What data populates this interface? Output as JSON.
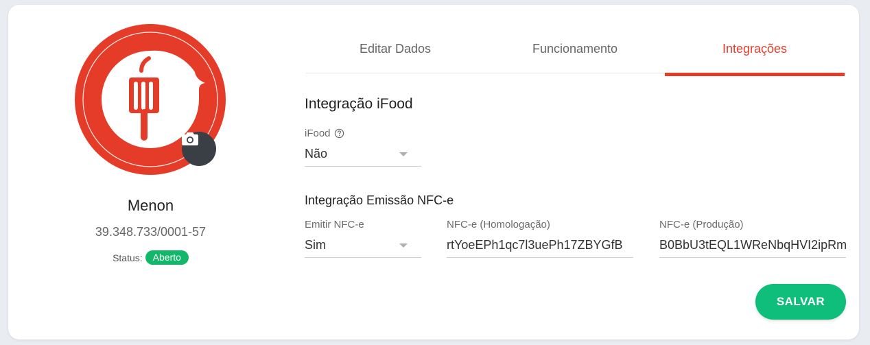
{
  "profile": {
    "name": "Menon",
    "cnpj": "39.348.733/0001-57",
    "status_label": "Status:",
    "status_value": "Aberto",
    "avatar_icon": "fork-speech-bubble-logo",
    "camera_icon": "camera-icon"
  },
  "tabs": [
    {
      "label": "Editar Dados",
      "active": false
    },
    {
      "label": "Funcionamento",
      "active": false
    },
    {
      "label": "Integrações",
      "active": true
    }
  ],
  "ifood": {
    "section_title": "Integração iFood",
    "field_label": "iFood",
    "value": "Não",
    "help_icon": "question-circle-icon"
  },
  "nfce": {
    "section_title": "Integração Emissão NFC-e",
    "emitir_label": "Emitir NFC-e",
    "emitir_value": "Sim",
    "homologacao_label": "NFC-e (Homologação)",
    "homologacao_value": "rtYoeEPh1qc7l3uePh17ZBYGfB",
    "producao_label": "NFC-e (Produção)",
    "producao_value": "B0BbU3tEQL1WReNbqHVI2ipRm"
  },
  "actions": {
    "save_label": "SALVAR"
  },
  "colors": {
    "brand_red": "#e53c29",
    "success_green": "#0fbe7a",
    "badge_green": "#12b76a"
  }
}
